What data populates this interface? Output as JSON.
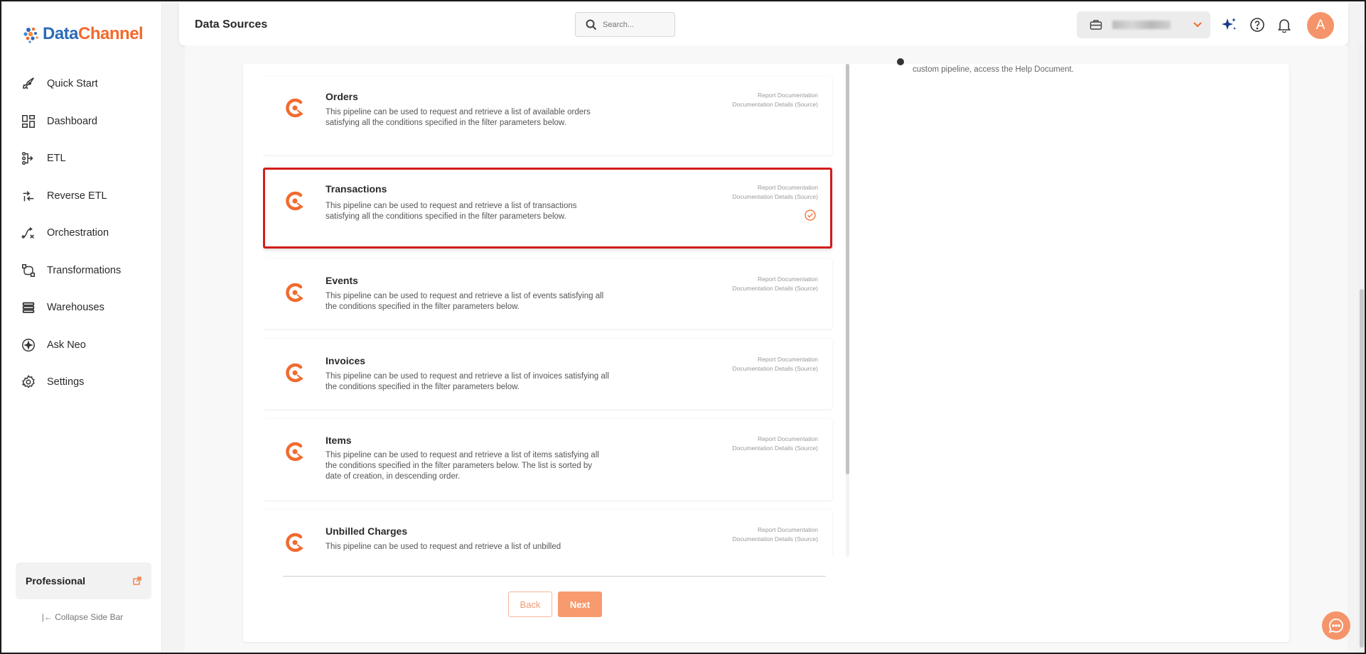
{
  "app": {
    "brand_part1": "Data",
    "brand_part2": "Channel",
    "page_title": "Data Sources"
  },
  "search": {
    "placeholder": "Search..."
  },
  "workspace": {
    "name": ""
  },
  "avatar": {
    "initial": "A"
  },
  "sidebar": {
    "items": [
      {
        "label": "Quick Start",
        "icon": "rocket-icon"
      },
      {
        "label": "Dashboard",
        "icon": "dashboard-icon"
      },
      {
        "label": "ETL",
        "icon": "etl-icon"
      },
      {
        "label": "Reverse ETL",
        "icon": "reverse-etl-icon"
      },
      {
        "label": "Orchestration",
        "icon": "orchestration-icon"
      },
      {
        "label": "Transformations",
        "icon": "transformations-icon"
      },
      {
        "label": "Warehouses",
        "icon": "warehouse-icon"
      },
      {
        "label": "Ask Neo",
        "icon": "sparkle-icon"
      },
      {
        "label": "Settings",
        "icon": "gear-icon"
      }
    ],
    "plan": "Professional",
    "collapse": "Collapse Side Bar"
  },
  "help": {
    "text": "custom pipeline, access the Help Document."
  },
  "card_links": {
    "report": "Report Documentation",
    "details": "Documentation Details (Source)"
  },
  "pipelines": [
    {
      "title": "Orders",
      "desc": "This pipeline can be used to request and retrieve a list of available orders satisfying all the conditions specified in the filter parameters below.",
      "selected": false
    },
    {
      "title": "Transactions",
      "desc": "This pipeline can be used to request and retrieve a list of transactions satisfying all the conditions specified in the filter parameters below.",
      "selected": true
    },
    {
      "title": "Events",
      "desc": "This pipeline can be used to request and retrieve a list of events satisfying all the conditions specified in the filter parameters below.",
      "selected": false
    },
    {
      "title": "Invoices",
      "desc": "This pipeline can be used to request and retrieve a list of invoices satisfying all the conditions specified in the filter parameters below.",
      "selected": false
    },
    {
      "title": "Items",
      "desc": "This pipeline can be used to request and retrieve a list of items satisfying all the conditions specified in the filter parameters below. The list is sorted by date of creation, in descending order.",
      "selected": false
    },
    {
      "title": "Unbilled Charges",
      "desc": "This pipeline can be used to request and retrieve a list of unbilled",
      "selected": false
    }
  ],
  "buttons": {
    "back": "Back",
    "next": "Next"
  },
  "colors": {
    "accent": "#f26a2e",
    "brand_blue": "#2c6bb7",
    "selection": "#d41c1c"
  }
}
